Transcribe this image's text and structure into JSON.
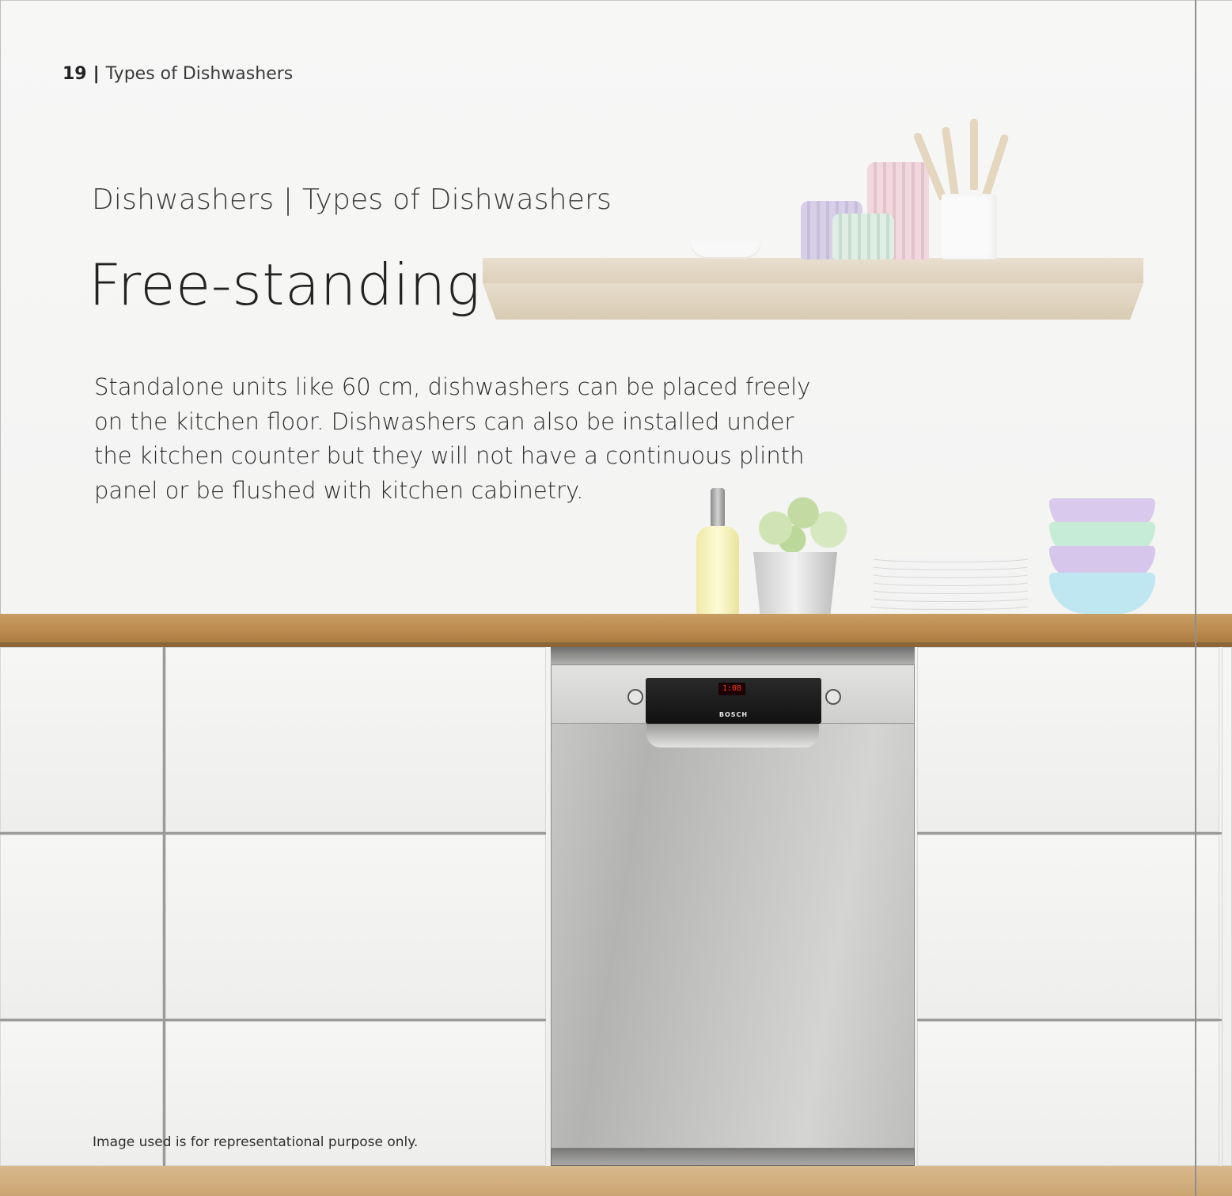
{
  "header": {
    "page_number": "19",
    "separator": "|",
    "section": "Types of Dishwashers"
  },
  "subtitle": "Dishwashers | Types of Dishwashers",
  "title": "Free-standing",
  "body": "Standalone units like 60 cm, dishwashers can be placed freely on the kitchen floor. Dishwashers can also be installed under the kitchen counter but they will not have a continuous plinth panel or be flushed with kitchen cabinetry.",
  "disclaimer": "Image used is for representational purpose only.",
  "appliance": {
    "brand": "BOSCH",
    "display": "1:08"
  },
  "colors": {
    "countertop": "#b9884d",
    "cabinet": "#f2f2f1",
    "steel": "#bdbdbb",
    "shelf": "#e3d7c3"
  }
}
